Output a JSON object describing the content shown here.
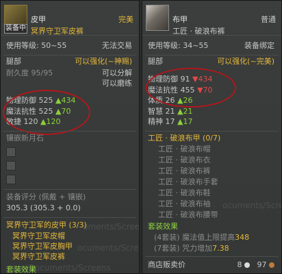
{
  "left": {
    "name": "皮甲",
    "quality": "完美",
    "equipped_badge": "装备中",
    "subtitle": "冥界守卫军皮裤",
    "level_label": "使用等级: 50~55",
    "trade": "无法交易",
    "slot": "腿部",
    "enhance": "可以强化(~神赐)",
    "durability": "耐久度 95/95",
    "can_decompose": "可以分解",
    "can_grind": "可以磨练",
    "stats": [
      {
        "label": "物理防御",
        "value": "525",
        "bonus": "▲434"
      },
      {
        "label": "魔法抗性",
        "value": "525",
        "bonus": "▲70"
      },
      {
        "label": "敏捷",
        "value": "120",
        "bonus": "▲120"
      }
    ],
    "socket_title": "镶嵌新月石",
    "score_label": "装备评分 (佩戴 + 镶嵌)",
    "score_value": "305.3 (305.3 + 0.0)",
    "set_title": "冥界守卫军的皮甲 (3/3)",
    "set_items": [
      "冥界守卫军皮帽",
      "冥界守卫军皮胸甲",
      "冥界守卫军皮裤"
    ],
    "set_effect_label": "套装效果",
    "watermark_1": "uments/ScreenS",
    "watermark_2": "ocuments/ScreenS",
    "watermark_3": "ser/Documents/Screens"
  },
  "right": {
    "name": "布甲",
    "quality": "普通",
    "subtitle": "工匠 · 破浪布裤",
    "level_label": "使用等级: 34~55",
    "bind": "装备绑定",
    "slot": "腿部",
    "enhance": "可以强化(~完美)",
    "stats": [
      {
        "label": "物理防御",
        "value": "91",
        "delta": "▼434",
        "dir": "down"
      },
      {
        "label": "魔法抗性",
        "value": "455",
        "delta": "▼70",
        "dir": "down"
      },
      {
        "label": "体质",
        "value": "26",
        "delta": "▲26",
        "dir": "up"
      },
      {
        "label": "智慧",
        "value": "21",
        "delta": "▲21",
        "dir": "up"
      },
      {
        "label": "精神",
        "value": "17",
        "delta": "▲17",
        "dir": "up"
      }
    ],
    "set_title": "工匠 · 破浪布甲 (0/7)",
    "set_items": [
      "工匠 · 破浪布帽",
      "工匠 · 破浪布衣",
      "工匠 · 破浪布裤",
      "工匠 · 破浪布手套",
      "工匠 · 破浪布鞋",
      "工匠 · 破浪布袖",
      "工匠 · 破浪布腰带"
    ],
    "set_effect_label": "套装效果",
    "set_effects": [
      {
        "text": "(4套装) 魔法值上限提高",
        "value": "348"
      },
      {
        "text": "(7套装) 咒力增加",
        "value": "7.38"
      }
    ],
    "sell_label": "商店贩卖价",
    "silver": "8",
    "copper": "97",
    "watermark_1": "ocuments/Screer"
  },
  "colors": {
    "gold": "#e6b83a",
    "green": "#8ed13c",
    "red": "#e14a4a",
    "highlight_ring": "#b0181c"
  }
}
